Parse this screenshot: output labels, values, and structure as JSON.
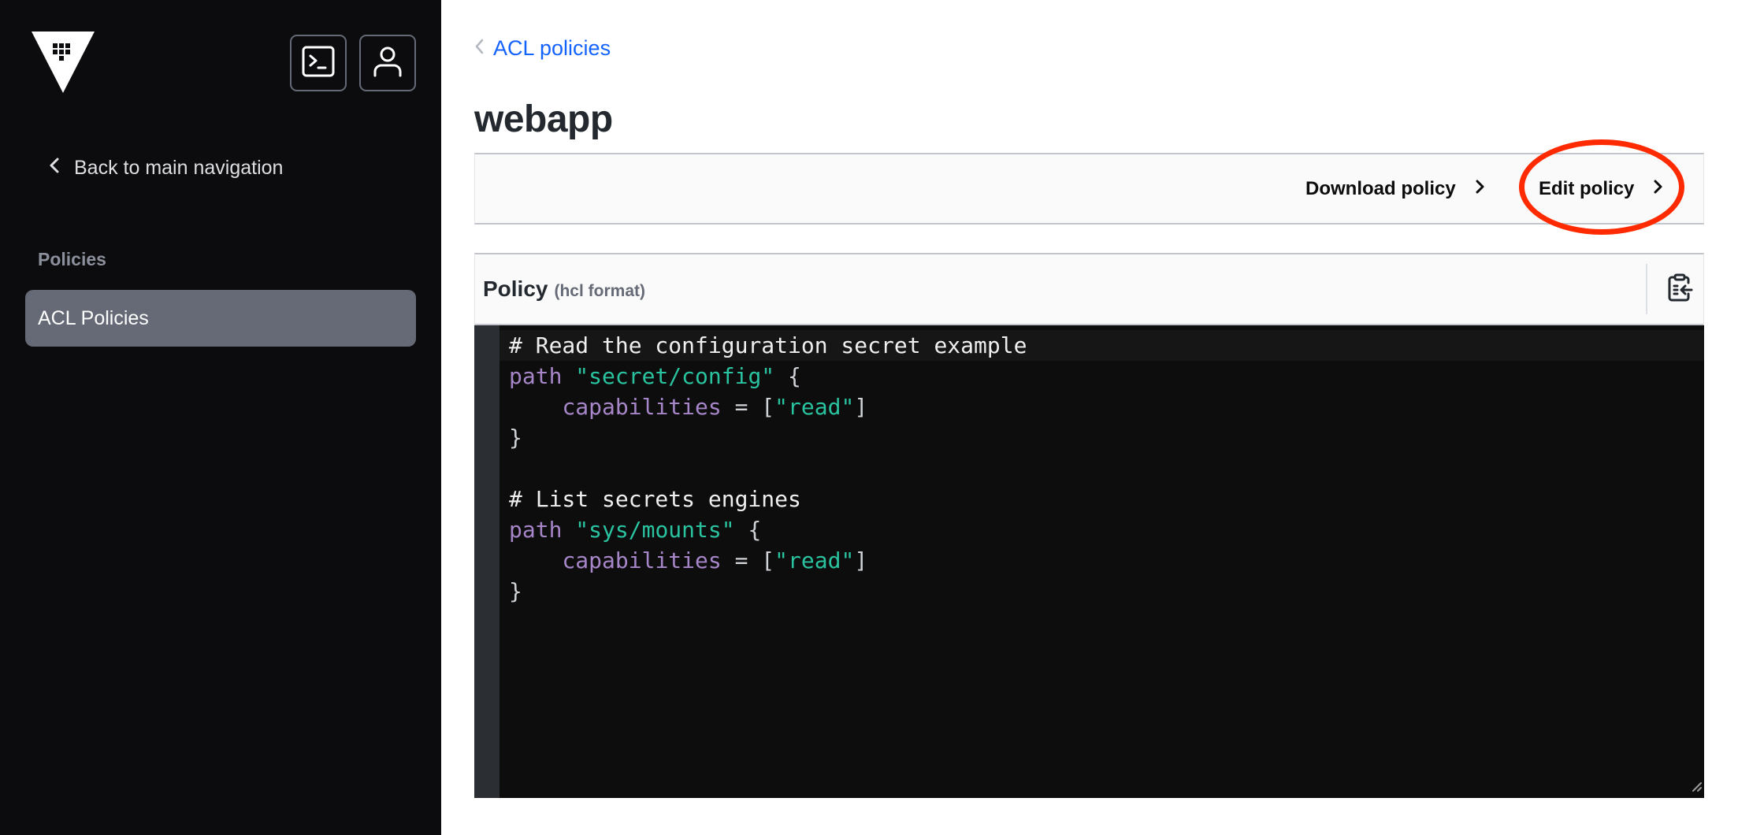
{
  "sidebar": {
    "logo": "vault-logo",
    "buttons": [
      {
        "name": "console",
        "icon": "terminal-icon"
      },
      {
        "name": "user-menu",
        "icon": "user-icon"
      }
    ],
    "back_label": "Back to main navigation",
    "section_label": "Policies",
    "items": [
      {
        "label": "ACL Policies",
        "active": true
      }
    ]
  },
  "breadcrumb": {
    "link_label": "ACL policies"
  },
  "page": {
    "title": "webapp"
  },
  "toolbar": {
    "download_label": "Download policy",
    "edit_label": "Edit policy"
  },
  "annotation": {
    "color": "#ff2a00",
    "target": "edit-policy-button"
  },
  "policy": {
    "title": "Policy",
    "format_label": "(hcl format)",
    "copy_icon": "clipboard-copy-icon"
  },
  "editor": {
    "lines": [
      [
        {
          "t": "comment",
          "v": "# Read the configuration secret example"
        }
      ],
      [
        {
          "t": "kw",
          "v": "path"
        },
        {
          "t": "punc",
          "v": " "
        },
        {
          "t": "str",
          "v": "\"secret/config\""
        },
        {
          "t": "punc",
          "v": " {"
        }
      ],
      [
        {
          "t": "punc",
          "v": "    "
        },
        {
          "t": "kw",
          "v": "capabilities"
        },
        {
          "t": "punc",
          "v": " = ["
        },
        {
          "t": "str",
          "v": "\"read\""
        },
        {
          "t": "punc",
          "v": "]"
        }
      ],
      [
        {
          "t": "punc",
          "v": "}"
        }
      ],
      [
        {
          "t": "punc",
          "v": ""
        }
      ],
      [
        {
          "t": "comment",
          "v": "# List secrets engines"
        }
      ],
      [
        {
          "t": "kw",
          "v": "path"
        },
        {
          "t": "punc",
          "v": " "
        },
        {
          "t": "str",
          "v": "\"sys/mounts\""
        },
        {
          "t": "punc",
          "v": " {"
        }
      ],
      [
        {
          "t": "punc",
          "v": "    "
        },
        {
          "t": "kw",
          "v": "capabilities"
        },
        {
          "t": "punc",
          "v": " = ["
        },
        {
          "t": "str",
          "v": "\"read\""
        },
        {
          "t": "punc",
          "v": "]"
        }
      ],
      [
        {
          "t": "punc",
          "v": "}"
        }
      ]
    ],
    "active_line": 0
  }
}
